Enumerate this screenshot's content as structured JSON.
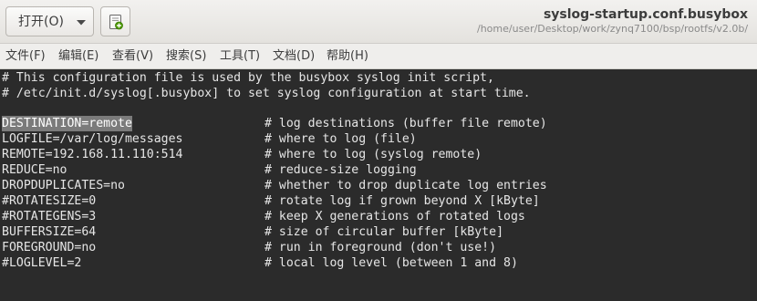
{
  "toolbar": {
    "open_label": "打开(O)",
    "open_dropdown_icon": "chevron-down-icon",
    "new_document_icon": "new-document-icon"
  },
  "window": {
    "title": "syslog-startup.conf.busybox",
    "path": "/home/user/Desktop/work/zynq7100/bsp/rootfs/v2.0b/"
  },
  "menu": [
    "文件(F)",
    "编辑(E)",
    "查看(V)",
    "搜索(S)",
    "工具(T)",
    "文档(D)",
    "帮助(H)"
  ],
  "editor": {
    "header_comments": [
      "# This configuration file is used by the busybox syslog init script,",
      "# /etc/init.d/syslog[.busybox] to set syslog configuration at start time."
    ],
    "entries": [
      {
        "setting": "DESTINATION=remote",
        "comment": "# log destinations (buffer file remote)",
        "selected": true
      },
      {
        "setting": "LOGFILE=/var/log/messages",
        "comment": "# where to log (file)"
      },
      {
        "setting": "REMOTE=192.168.11.110:514",
        "comment": "# where to log (syslog remote)"
      },
      {
        "setting": "REDUCE=no",
        "comment": "# reduce-size logging"
      },
      {
        "setting": "DROPDUPLICATES=no",
        "comment": "# whether to drop duplicate log entries"
      },
      {
        "setting": "#ROTATESIZE=0",
        "comment": "# rotate log if grown beyond X [kByte]"
      },
      {
        "setting": "#ROTATEGENS=3",
        "comment": "# keep X generations of rotated logs"
      },
      {
        "setting": "BUFFERSIZE=64",
        "comment": "# size of circular buffer [kByte]"
      },
      {
        "setting": "FOREGROUND=no",
        "comment": "# run in foreground (don't use!)"
      },
      {
        "setting": "#LOGLEVEL=2",
        "comment": "# local log level (between 1 and 8)"
      }
    ]
  },
  "colors": {
    "editor_background": "#2b2b2b",
    "editor_text": "#e6e6e6",
    "selection_background": "#7b7b7b",
    "chrome_background": "#efeeec"
  }
}
